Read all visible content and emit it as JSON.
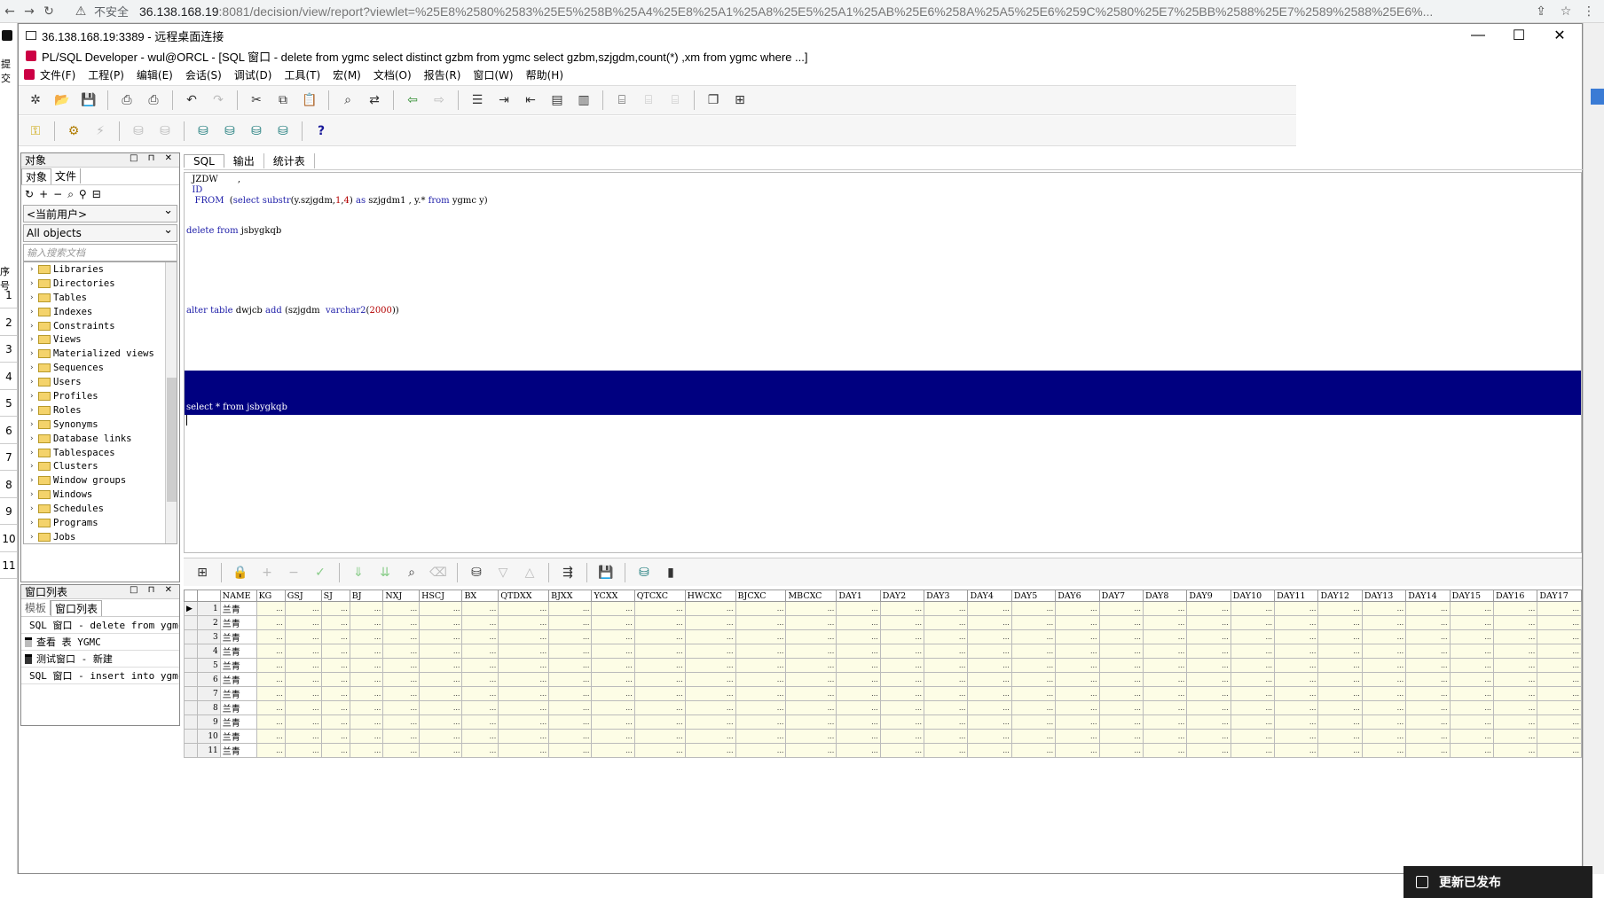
{
  "browser": {
    "not_secure": "不安全",
    "url_host": "36.138.168.19",
    "url_rest": ":8081/decision/view/report?viewlet=%25E8%2580%2583%25E5%258B%25A4%25E8%25A1%25A8%25E5%25A1%25AB%25E6%258A%25A5%25E6%259C%2580%25E7%25BB%2588%25E7%2589%2588%25E6%..."
  },
  "left_strip": {
    "label_top": "提交",
    "label_mid": "序号",
    "rows": [
      "1",
      "2",
      "3",
      "4",
      "5",
      "6",
      "7",
      "8",
      "9",
      "10",
      "11"
    ]
  },
  "rdp": {
    "title": "36.138.168.19:3389 - 远程桌面连接",
    "minimize": "—",
    "maximize": "☐",
    "close": "✕"
  },
  "plsql": {
    "title": "PL/SQL Developer - wul@ORCL - [SQL 窗口 - delete from ygmc select distinct gzbm from ygmc select gzbm,szjgdm,count(*) ,xm from ygmc where  ...]",
    "menu": [
      "文件(F)",
      "工程(P)",
      "编辑(E)",
      "会话(S)",
      "调试(D)",
      "工具(T)",
      "宏(M)",
      "文档(O)",
      "报告(R)",
      "窗口(W)",
      "帮助(H)"
    ]
  },
  "object_panel": {
    "title": "对象",
    "tabs": [
      "对象",
      "文件"
    ],
    "owner_select": "<当前用户>",
    "type_select": "All objects",
    "search_placeholder": "输入搜索文档",
    "tree": [
      "Libraries",
      "Directories",
      "Tables",
      "Indexes",
      "Constraints",
      "Views",
      "Materialized views",
      "Sequences",
      "Users",
      "Profiles",
      "Roles",
      "Synonyms",
      "Database links",
      "Tablespaces",
      "Clusters",
      "Window groups",
      "Windows",
      "Schedules",
      "Programs",
      "Jobs"
    ]
  },
  "window_list": {
    "title": "窗口列表",
    "tabs": [
      "模板",
      "窗口列表"
    ],
    "items": [
      "SQL 窗口 - delete from ygmc",
      "查看 表 YGMC",
      "测试窗口 - 新建",
      "SQL 窗口 - insert into ygmc"
    ]
  },
  "editor": {
    "tabs": [
      "SQL",
      "输出",
      "统计表"
    ],
    "line1": "  JZDW       ,",
    "line2_kw": "  ID",
    "line3_from": "   FROM",
    "line3_a": "  (",
    "line3_select": "select",
    "line3_substr": " substr",
    "line3_b": "(y.szjgdm,",
    "line3_n1": "1",
    "line3_c": ",",
    "line3_n2": "4",
    "line3_d": ") ",
    "line3_as": "as",
    "line3_e": " szjgdm1 , y.* ",
    "line3_from2": "from",
    "line3_f": " ygmc y)",
    "line4_del": "delete",
    "line4_a": " ",
    "line4_from": "from",
    "line4_b": " jsbygkqb",
    "line5_alter": "alter",
    "line5_a": " ",
    "line5_table": "table",
    "line5_b": " dwjcb ",
    "line5_add": "add",
    "line5_c": " (szjgdm  ",
    "line5_type": "varchar2",
    "line5_d": "(",
    "line5_n": "2000",
    "line5_e": "))",
    "selected": "select * from jsbygkqb"
  },
  "grid": {
    "columns": [
      "NAME",
      "KG",
      "GSJ",
      "SJ",
      "BJ",
      "NXJ",
      "HSCJ",
      "BX",
      "QTDXX",
      "BJXX",
      "YCXX",
      "QTCXC",
      "HWCXC",
      "BJCXC",
      "MBCXC",
      "DAY1",
      "DAY2",
      "DAY3",
      "DAY4",
      "DAY5",
      "DAY6",
      "DAY7",
      "DAY8",
      "DAY9",
      "DAY10",
      "DAY11",
      "DAY12",
      "DAY13",
      "DAY14",
      "DAY15",
      "DAY16",
      "DAY17"
    ],
    "row_numbers": [
      "1",
      "2",
      "3",
      "4",
      "5",
      "6",
      "7",
      "8",
      "9",
      "10",
      "11"
    ],
    "name_value": "兰青",
    "ellipsis": "..."
  },
  "toast": {
    "text": "更新已发布"
  }
}
